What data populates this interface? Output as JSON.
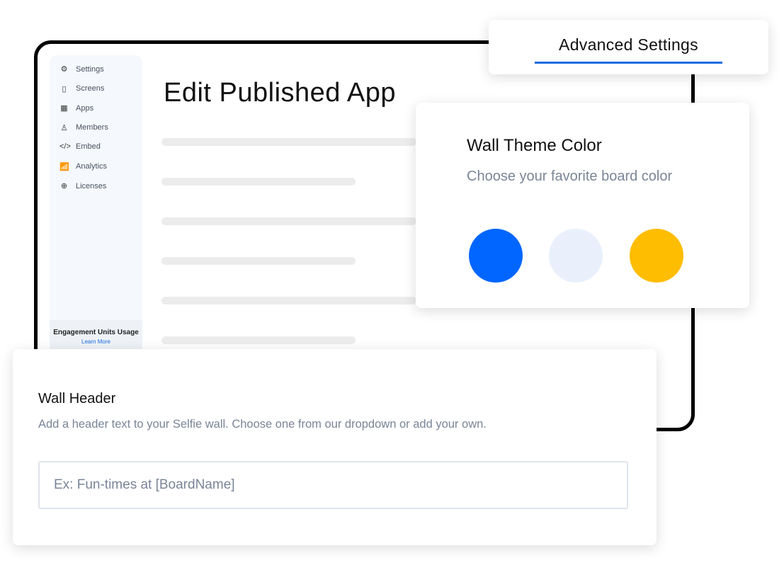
{
  "sidebar": {
    "items": [
      {
        "label": "Settings",
        "icon": "gear-icon",
        "glyph": "⚙"
      },
      {
        "label": "Screens",
        "icon": "screen-icon",
        "glyph": "▯"
      },
      {
        "label": "Apps",
        "icon": "apps-grid-icon",
        "glyph": "▦"
      },
      {
        "label": "Members",
        "icon": "user-icon",
        "glyph": "♙"
      },
      {
        "label": "Embed",
        "icon": "code-icon",
        "glyph": "</>"
      },
      {
        "label": "Analytics",
        "icon": "analytics-icon",
        "glyph": "📶"
      },
      {
        "label": "Licenses",
        "icon": "upload-circle-icon",
        "glyph": "⊕"
      }
    ],
    "usage_title": "Engagement Units Usage",
    "learn_more": "Learn More"
  },
  "main": {
    "title": "Edit Published App"
  },
  "advanced": {
    "label": "Advanced Settings",
    "accent": "#1a6ce0"
  },
  "theme": {
    "title": "Wall Theme Color",
    "subtitle": "Choose your favorite board color",
    "colors": [
      "#0066ff",
      "#e9f0fc",
      "#ffbd00"
    ]
  },
  "wall_header": {
    "title": "Wall Header",
    "subtitle": "Add a header text to your Selfie wall. Choose one from our dropdown or add your own.",
    "placeholder": "Ex: Fun-times at [BoardName]",
    "value": ""
  }
}
